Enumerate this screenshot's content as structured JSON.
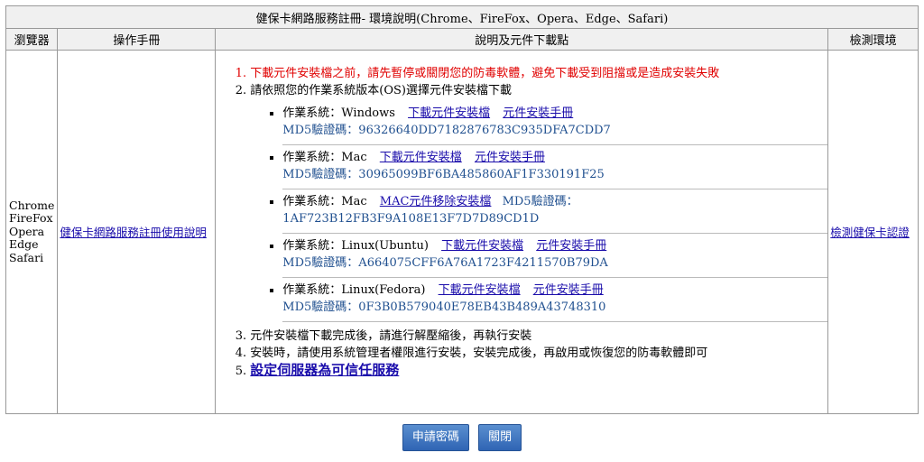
{
  "header": {
    "title": "健保卡網路服務註冊- 環境說明(Chrome、FireFox、Opera、Edge、Safari)",
    "col_browser": "瀏覽器",
    "col_manual": "操作手冊",
    "col_download": "說明及元件下載點",
    "col_detect": "檢測環境"
  },
  "browsers": [
    "Chrome",
    "FireFox",
    "Opera",
    "Edge",
    "Safari"
  ],
  "manual_link": "健保卡網路服務註冊使用說明",
  "detect_link": "檢測健保卡認證",
  "steps": {
    "s1": "下載元件安裝檔之前，請先暫停或關閉您的防毒軟體，避免下載受到阻擋或是造成安裝失敗",
    "s2": "請依照您的作業系統版本(OS)選擇元件安裝檔下載",
    "s3": "元件安裝檔下載完成後，請進行解壓縮後，再執行安裝",
    "s4": "安裝時，請使用系統管理者權限進行安裝，安裝完成後，再啟用或恢復您的防毒軟體即可",
    "s5": "設定伺服器為可信任服務"
  },
  "os_items": [
    {
      "os": "作業系統：Windows",
      "dl": "下載元件安裝檔",
      "manual": "元件安裝手冊",
      "md5": "MD5驗證碼：96326640DD7182876783C935DFA7CDD7"
    },
    {
      "os": "作業系統：Mac",
      "dl": "下載元件安裝檔",
      "manual": "元件安裝手冊",
      "md5": "MD5驗證碼：30965099BF6BA485860AF1F330191F25"
    },
    {
      "os": "作業系統：Mac",
      "dl": "MAC元件移除安裝檔",
      "md5_label": "MD5驗證碼：",
      "md5": "1AF723B12FB3F9A108E13F7D7D89CD1D"
    },
    {
      "os": "作業系統：Linux(Ubuntu)",
      "dl": "下載元件安裝檔",
      "manual": "元件安裝手冊",
      "md5": "MD5驗證碼：A664075CFF6A76A1723F4211570B79DA"
    },
    {
      "os": "作業系統：Linux(Fedora)",
      "dl": "下載元件安裝檔",
      "manual": "元件安裝手冊",
      "md5": "MD5驗證碼：0F3B0B579040E78EB43B489A43748310"
    }
  ],
  "buttons": {
    "apply": "申請密碼",
    "close": "關閉"
  }
}
